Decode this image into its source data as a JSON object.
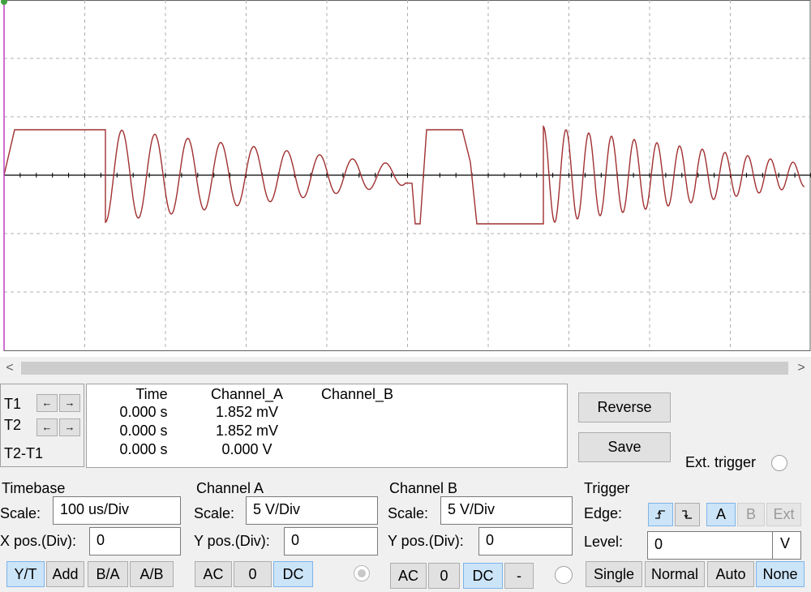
{
  "scope": {
    "grid_cols": 10,
    "grid_rows": 6,
    "trace_color": "#a03030"
  },
  "scrollbar": {
    "left_arrow": "<",
    "right_arrow": ">"
  },
  "cursors": {
    "t1_label": "T1",
    "t2_label": "T2",
    "diff_label": "T2-T1",
    "left_arrow": "←",
    "right_arrow": "→"
  },
  "readout": {
    "headers": [
      "Time",
      "Channel_A",
      "Channel_B"
    ],
    "rows": [
      {
        "time": "0.000 s",
        "channel_a": "1.852 mV",
        "channel_b": ""
      },
      {
        "time": "0.000 s",
        "channel_a": "1.852 mV",
        "channel_b": ""
      },
      {
        "time": "0.000 s",
        "channel_a": "0.000 V",
        "channel_b": ""
      }
    ]
  },
  "buttons": {
    "reverse": "Reverse",
    "save": "Save"
  },
  "ext_trigger": {
    "label": "Ext. trigger"
  },
  "timebase": {
    "title": "Timebase",
    "scale_label": "Scale:",
    "scale_value": "100 us/Div",
    "xpos_label": "X pos.(Div):",
    "xpos_value": "0",
    "modes": [
      "Y/T",
      "Add",
      "B/A",
      "A/B"
    ]
  },
  "channel_a": {
    "title": "Channel A",
    "scale_label": "Scale:",
    "scale_value": "5  V/Div",
    "ypos_label": "Y pos.(Div):",
    "ypos_value": "0",
    "coupling": [
      "AC",
      "0",
      "DC"
    ]
  },
  "channel_b": {
    "title": "Channel B",
    "scale_label": "Scale:",
    "scale_value": "5  V/Div",
    "ypos_label": "Y pos.(Div):",
    "ypos_value": "0",
    "coupling": [
      "AC",
      "0",
      "DC",
      "-"
    ]
  },
  "trigger": {
    "title": "Trigger",
    "edge_label": "Edge:",
    "sources": [
      "A",
      "B",
      "Ext"
    ],
    "level_label": "Level:",
    "level_value": "0",
    "level_unit": "V",
    "modes": [
      "Single",
      "Normal",
      "Auto",
      "None"
    ]
  }
}
